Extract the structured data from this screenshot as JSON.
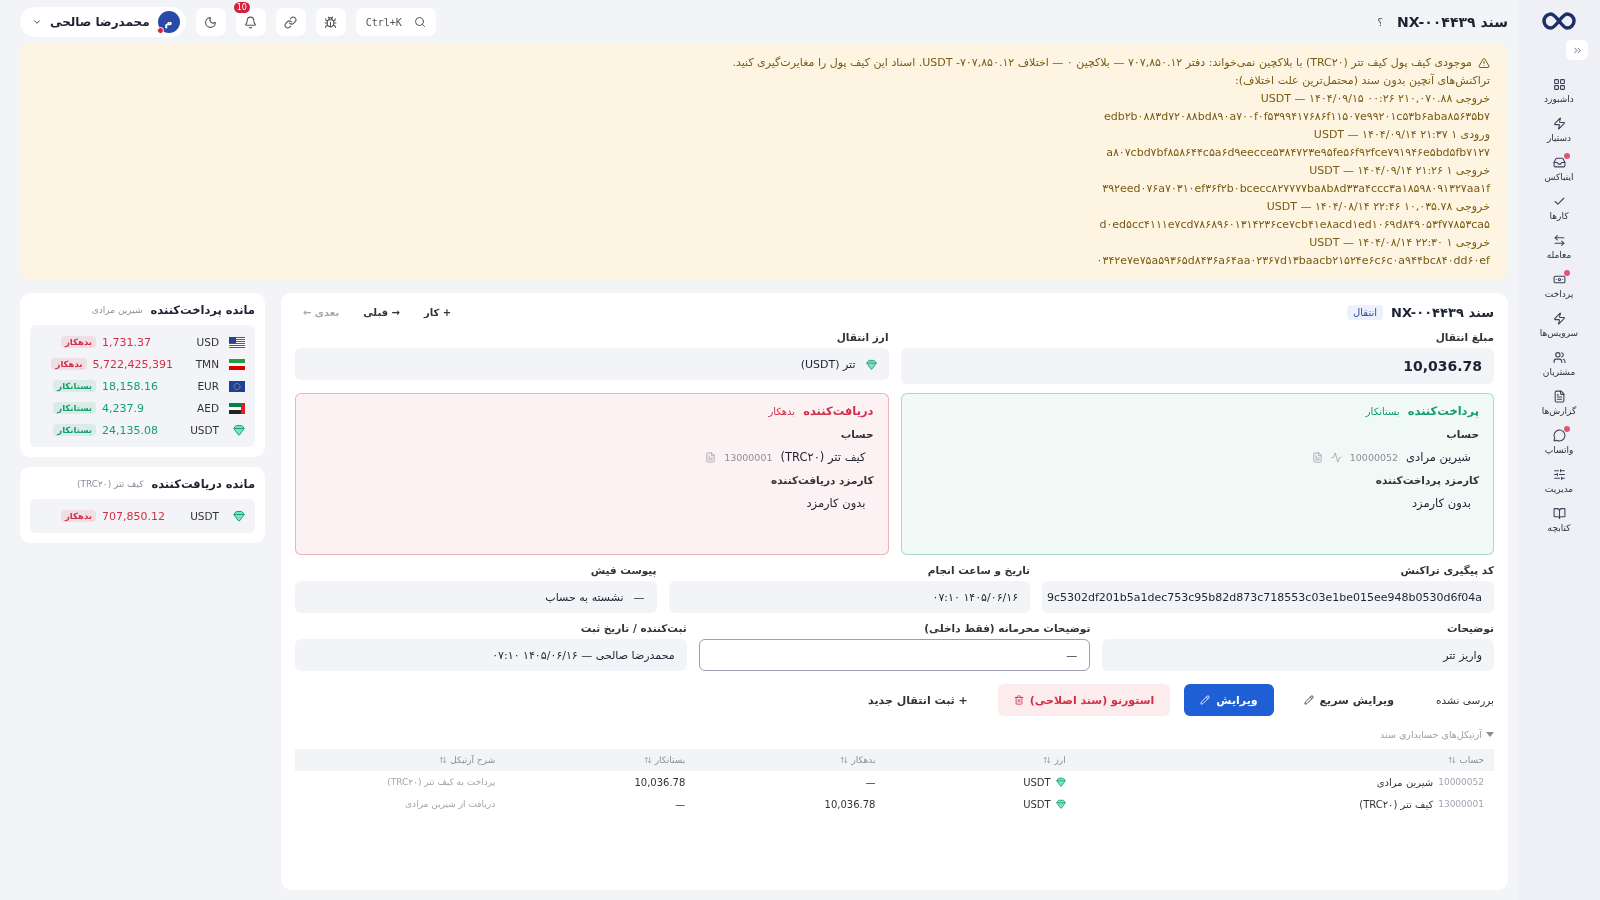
{
  "header": {
    "title": "سند NX-۰۰۴۴۳۹",
    "help": "؟",
    "search_shortcut": "Ctrl+K",
    "notifications_count": "10",
    "user": {
      "initial": "م",
      "name": "محمدرضا صالحی"
    }
  },
  "sidebar": {
    "items": [
      {
        "label": "داشبورد",
        "has_dot": false
      },
      {
        "label": "دستیار",
        "has_dot": false
      },
      {
        "label": "اینباکس",
        "has_dot": true
      },
      {
        "label": "کارها",
        "has_dot": false
      },
      {
        "label": "معامله",
        "has_dot": false
      },
      {
        "label": "پرداخت",
        "has_dot": true
      },
      {
        "label": "سرویس‌ها",
        "has_dot": false
      },
      {
        "label": "مشتریان",
        "has_dot": false
      },
      {
        "label": "گزارش‌ها",
        "has_dot": false
      },
      {
        "label": "واتساپ",
        "has_dot": true
      },
      {
        "label": "مدیریت",
        "has_dot": false
      },
      {
        "label": "کتابچه",
        "has_dot": false
      }
    ]
  },
  "warning": {
    "message": "موجودی کیف پول کیف تتر (TRC۲۰) با بلاکچین نمی‌خواند: دفتر ۷۰۷,۸۵۰.۱۲ — بلاکچین ۰ — اختلاف ۷۰۷,۸۵۰.۱۲- USDT. اسناد این کیف پول را مغایرت‌گیری کنید.",
    "subtitle": "تراکنش‌های آنچین بدون سند (محتمل‌ترین علت اختلاف):",
    "transactions": [
      {
        "summary": "خروجی ۲۱۰,۰۷۰.۸۸ ۰۰:۲۶ ۱۴۰۴/۰۹/۱۵ — USDT",
        "hash": "edb۲b۰۸۸۳d۷۲۰۸۸bd۸۹۰a۷۰۰f۰f۵۳۹۹۴۱۷۶۸۶f۱۱۵۰۷e۹۹۲۰۱c۵۳b۶aba۸۵۶۳۵b۷"
      },
      {
        "summary": "ورودی ۱ ۲۱:۳۷ ۱۴۰۴/۰۹/۱۴ — USDT",
        "hash": "a۸۰۷cbd۷bf۸۵۸۶۴۴c۵a۶d۹eecce۵۳۸۴۷۲۳e۹۵fe۵۶f۹۲fce۷۹۱۹۴۶e۵bd۵fb۷۱۲۷"
      },
      {
        "summary": "خروجی ۱ ۲۱:۲۶ ۱۴۰۴/۰۹/۱۴ — USDT",
        "hash": "۳۹۲eed۰۷۶a۷۰۳۱۰ef۳۶f۲b۰bcecc۸۲۷۷۷۷ba۸b۸d۳۳a۴ccc۳a۱۸۵۹۸۰۹۱۳۲۷aa۱f"
      },
      {
        "summary": "خروجی ۱۰,۰۳۵.۷۸ ۲۲:۴۶ ۱۴۰۴/۰۸/۱۴ — USDT",
        "hash": "d۰ed۵cc۴۱۱۱e۷cd۷۸۶۸۹۶۰۱۳۱۴۲۳۶ce۷cb۴۱e۸acd۱ed۱۰۶۹d۸۴۹۰۵۳f۷۷۸۵۳ca۵"
      },
      {
        "summary": "خروجی ۱ ۲۲:۳۰ ۱۴۰۴/۰۸/۱۴ — USDT",
        "hash": "۰۳۴۲e۷e۷۵a۵۹۳۶۵d۸۴۳۶a۶۴aa۰۲۳۶۷d۱۳baacb۲۱۵۲۴e۶c۶c۰a۹۴۴bc۸۴۰dd۶۰ef"
      }
    ]
  },
  "document": {
    "title": "سند NX-۰۰۴۴۳۹",
    "tag": "انتقال",
    "nav": [
      {
        "label": "+ کار",
        "disabled": false
      },
      {
        "label": "→ قبلی",
        "disabled": false
      },
      {
        "label": "بعدی ←",
        "disabled": true
      }
    ],
    "amount": {
      "label": "مبلغ انتقال",
      "value": "10,036.78"
    },
    "currency": {
      "label": "ارز انتقال",
      "value": "تتر (USDT)"
    },
    "parties": [
      {
        "title": "پرداخت‌کننده",
        "status": "بستانکار",
        "color": "#13a06b",
        "account_label": "حساب",
        "account_name": "شیرین مرادی",
        "account_code": "10000052",
        "fee_label": "کارمزد پرداخت‌کننده",
        "fee": "بدون کارمزد"
      },
      {
        "title": "دریافت‌کننده",
        "status": "بدهکار",
        "color": "#d12f48",
        "account_label": "حساب",
        "account_name": "کیف تتر (TRC۲۰)",
        "account_code": "13000001",
        "fee_label": "کارمزد دریافت‌کننده",
        "fee": "بدون کارمزد"
      }
    ],
    "tracking": {
      "label": "کد پیگیری تراکنش",
      "value": "9c5302df201b5a1dec753c95b82d873c718553c03e1be015ee948b0530d6f04a"
    },
    "datetime": {
      "label": "تاریخ و ساعت انجام",
      "value": "۱۴۰۵/۰۶/۱۶ ۰۷:۱۰"
    },
    "receipt": {
      "label": "پیوست فیش",
      "dash": "—",
      "value": "نشسته به حساب"
    },
    "description": {
      "label": "توضیحات",
      "value": "واریز تتر"
    },
    "private_note": {
      "label": "توضیحات محرمانه (فقط داخلی)",
      "value": "—"
    },
    "registrar": {
      "label": "ثبت‌کننده / تاریخ ثبت",
      "value": "محمدرضا صالحی — ۱۴۰۵/۰۶/۱۶ ۰۷:۱۰"
    },
    "review_status": "بررسی نشده",
    "actions": [
      {
        "kind": "link",
        "label": "ویرایش سریع"
      },
      {
        "kind": "primary",
        "label": "ویرایش"
      },
      {
        "kind": "danger",
        "label": "استورنو (سند اصلاحی)"
      },
      {
        "kind": "plain",
        "label": "+ ثبت انتقال جدید"
      }
    ],
    "articles": {
      "title": "آرتیکل‌های حسابداری سند",
      "expanded": true,
      "columns": [
        "حساب",
        "ارز",
        "بدهکار",
        "بستانکار",
        "شرح آرتیکل"
      ],
      "rows": [
        {
          "code": "10000052",
          "account": "شیرین مرادی",
          "currency": "USDT",
          "debit": "—",
          "credit": "10,036.78",
          "description": "پرداخت به کیف تتر (TRC۲۰)"
        },
        {
          "code": "13000001",
          "account": "کیف تتر (TRC۲۰)",
          "currency": "USDT",
          "debit": "10,036.78",
          "credit": "—",
          "description": "دریافت از شیرین مرادی"
        }
      ]
    }
  },
  "balances": [
    {
      "title": "مانده پرداخت‌کننده",
      "subtitle": "شیرین مرادی",
      "rows": [
        {
          "kind": "us",
          "code": "USD",
          "amount": "1,731.37",
          "status": "بدهکار",
          "color": "#d12f48"
        },
        {
          "kind": "ir",
          "code": "TMN",
          "amount": "5,722,425,391",
          "status": "بدهکار",
          "color": "#d12f48"
        },
        {
          "kind": "eu",
          "code": "EUR",
          "amount": "18,158.16",
          "status": "بستانکار",
          "color": "#13a06b"
        },
        {
          "kind": "ae",
          "code": "AED",
          "amount": "4,237.9",
          "status": "بستانکار",
          "color": "#13a06b"
        },
        {
          "kind": "tether",
          "code": "USDT",
          "amount": "24,135.08",
          "status": "بستانکار",
          "color": "#13a06b"
        }
      ]
    },
    {
      "title": "مانده دریافت‌کننده",
      "subtitle": "کیف تتر (TRC۲۰)",
      "rows": [
        {
          "kind": "tether",
          "code": "USDT",
          "amount": "707,850.12",
          "status": "بدهکار",
          "color": "#d12f48"
        }
      ]
    }
  ]
}
